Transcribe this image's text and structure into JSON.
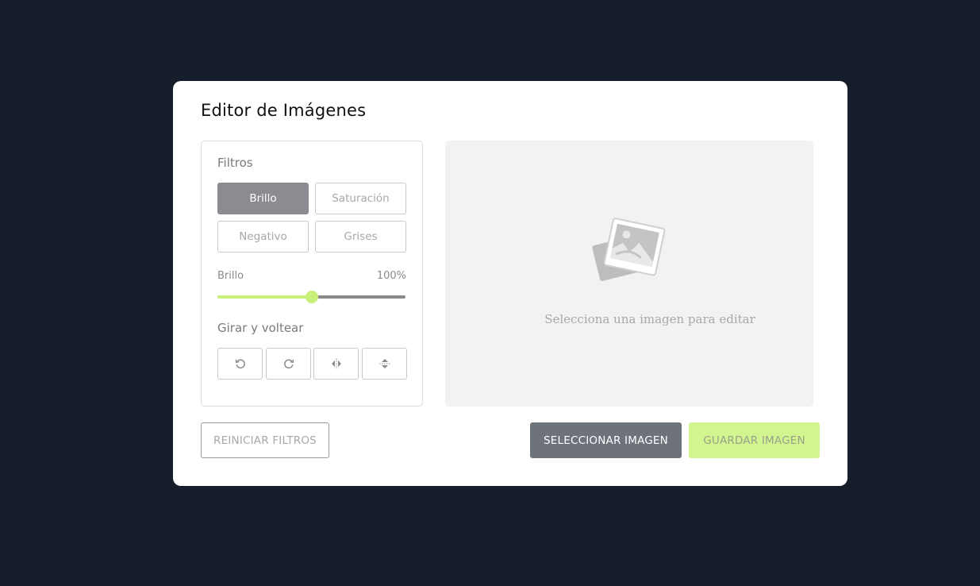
{
  "app": {
    "title": "Editor de Imágenes"
  },
  "filters": {
    "label": "Filtros",
    "options": [
      {
        "label": "Brillo",
        "active": true
      },
      {
        "label": "Saturación",
        "active": false
      },
      {
        "label": "Negativo",
        "active": false
      },
      {
        "label": "Grises",
        "active": false
      }
    ]
  },
  "slider": {
    "name": "Brillo",
    "value_text": "100%",
    "value": 100,
    "max": 200
  },
  "rotate": {
    "label": "Girar y voltear",
    "buttons": [
      {
        "icon": "rotate-left-icon"
      },
      {
        "icon": "rotate-right-icon"
      },
      {
        "icon": "flip-horizontal-icon"
      },
      {
        "icon": "flip-vertical-icon"
      }
    ]
  },
  "preview": {
    "icon": "image-placeholder-icon",
    "placeholder_text": "Selecciona una imagen para editar"
  },
  "actions": {
    "reset_label": "REINICIAR FILTROS",
    "select_label": "SELECCIONAR IMAGEN",
    "save_label": "GUARDAR IMAGEN"
  },
  "colors": {
    "background": "#161e2c",
    "accent": "#c8f07a",
    "active_filter": "#8a8c92",
    "select_button": "#6d727b",
    "save_button": "#d3f58f"
  }
}
